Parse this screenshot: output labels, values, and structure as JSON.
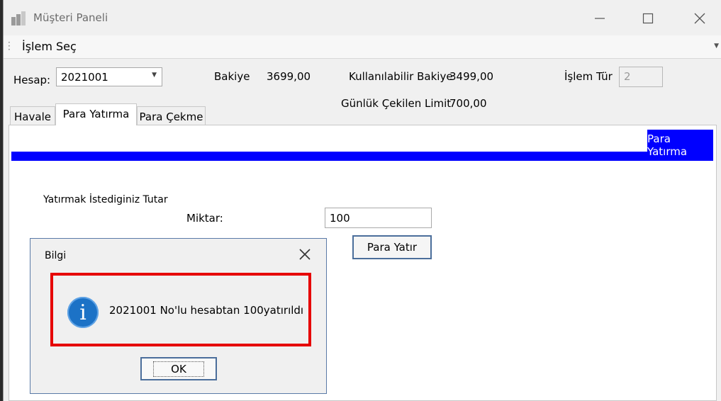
{
  "window": {
    "title": "Müşteri Paneli"
  },
  "menu": {
    "item": "İşlem Seç"
  },
  "account": {
    "label": "Hesap:",
    "value": "2021001",
    "bakiye_label": "Bakiye",
    "bakiye_value": "3699,00",
    "kullanilabilir_label": "Kullanılabilir Bakiye",
    "kullanilabilir_value": "3499,00",
    "islem_label": "İşlem Tür",
    "islem_value": "2",
    "limit_label": "Günlük Çekilen Limit",
    "limit_value": "700,00"
  },
  "tabs": [
    {
      "label": "Havale"
    },
    {
      "label": "Para Yatırma"
    },
    {
      "label": "Para Çekme"
    }
  ],
  "panel": {
    "header": "Para Yatırma",
    "section_label": "Yatırmak İstediginiz Tutar",
    "amount_label": "Miktar:",
    "amount_value": "100",
    "submit_label": "Para Yatır"
  },
  "dialog": {
    "title": "Bilgi",
    "message": "2021001 No'lu hesabtan 100yatırıldı",
    "ok_label": "OK",
    "icon": "info-icon",
    "highlight_color": "#e60000"
  },
  "colors": {
    "accent": "#0000ff",
    "info": "#1c72c6"
  }
}
